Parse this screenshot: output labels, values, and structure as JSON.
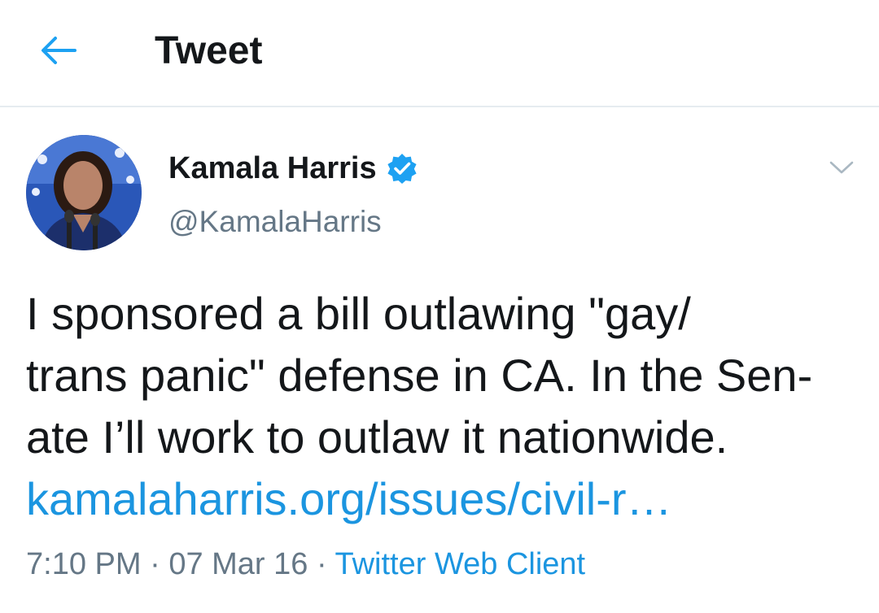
{
  "header": {
    "back_icon": "arrow-left-icon",
    "title": "Tweet"
  },
  "tweet": {
    "display_name": "Kamala Harris",
    "verified_icon": "verified-badge-icon",
    "handle": "@KamalaHarris",
    "caret_icon": "chevron-down-icon",
    "text_lines": [
      "I sponsored a bill outlawing \"gay/",
      "trans panic\" defense in CA. In the Sen-",
      "ate I’ll work to outlaw it nationwide."
    ],
    "link": "kamalaharris.org/issues/civil-r…",
    "time": "7:10 PM",
    "separator": " · ",
    "date": "07 Mar 16",
    "source": "Twitter Web Client"
  },
  "colors": {
    "accent": "#1b95e0",
    "text": "#14171a",
    "secondary": "#657786",
    "divider": "#e6ecf0"
  }
}
